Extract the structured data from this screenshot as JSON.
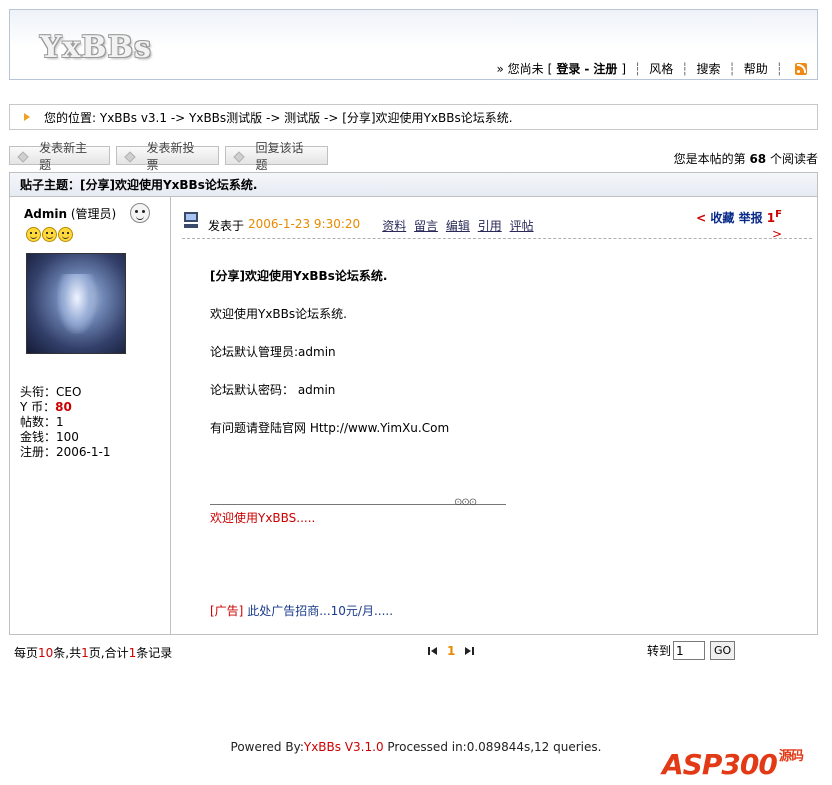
{
  "header": {
    "logo": "YxBBs",
    "nav": {
      "prefix": "» 您尚未",
      "bracket_open": "[",
      "login": "登录",
      "dash": "-",
      "register": "注册",
      "bracket_close": "]",
      "style": "风格",
      "search": "搜索",
      "help": "帮助"
    }
  },
  "breadcrumb": "您的位置: YxBBs v3.1 -> YxBBs测试版 -> 测试版 -> [分享]欢迎使用YxBBs论坛系统.",
  "actions": {
    "new_topic": "发表新主题",
    "new_poll": "发表新投票",
    "reply": "回复该话题"
  },
  "readers": {
    "prefix": "您是本帖的第",
    "count": "68",
    "suffix": "个阅读者"
  },
  "thread": {
    "title": "贴子主题：[分享]欢迎使用YxBBs论坛系统.",
    "author": {
      "name": "Admin",
      "role": "(管理员)"
    },
    "stats": {
      "title_label": "头衔：",
      "title_value": "CEO",
      "coins_label": "Y 币：",
      "coins_value": "80",
      "posts_label": "帖数：",
      "posts_value": "1",
      "money_label": "金钱：",
      "money_value": "100",
      "reg_label": "注册：",
      "reg_value": "2006-1-1"
    },
    "post": {
      "posted_at_label": "发表于",
      "posted_at": "2006-1-23 9:30:20",
      "links": [
        "资料",
        "留言",
        "编辑",
        "引用",
        "评帖"
      ],
      "fav_lt": "<",
      "favorite": "收藏",
      "report": "举报",
      "floor": "1",
      "floor_sup": "F",
      "gt": ">",
      "body_title": "[分享]欢迎使用YxBBs论坛系统.",
      "lines": [
        "欢迎使用YxBBs论坛系统.",
        "论坛默认管理员:admin",
        "论坛默认密码： admin",
        "有问题请登陆官网 Http://www.YimXu.Com"
      ],
      "signature": "欢迎使用YxBBS.....",
      "ad_tag": "[广告]",
      "ad_text": "此处广告招商...10元/月....."
    }
  },
  "pager": {
    "per_page_prefix": "每页",
    "per_page": "10",
    "per_page_mid": "条,共",
    "pages": "1",
    "pages_mid": "页,合计",
    "records": "1",
    "records_suffix": "条记录",
    "current": "1",
    "goto_label": "转到",
    "goto_value": "1",
    "go": "GO"
  },
  "footer": {
    "powered_prefix": "Powered By:",
    "product": "YxBBs V3.1.0",
    "processed": " Processed in:0.089844s,12 queries."
  },
  "watermark": {
    "text": "ASP300",
    "sub": "源码"
  },
  "colors": {
    "accent_red": "#cc0000",
    "date_orange": "#e68a00",
    "link_blue": "#0a2a8a"
  }
}
